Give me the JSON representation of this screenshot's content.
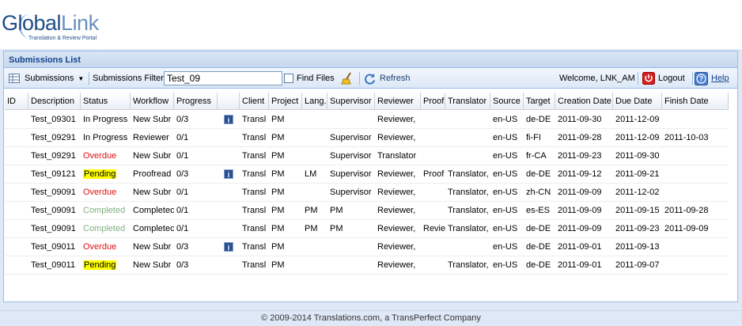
{
  "logo": {
    "name_part1": "Global",
    "name_part2": "Link",
    "subtitle": "Translation & Review Portal"
  },
  "panel": {
    "title": "Submissions List"
  },
  "toolbar": {
    "submissions_menu": "Submissions",
    "filter_label": "Submissions Filter",
    "filter_value": "Test_09",
    "find_files_label": "Find Files",
    "refresh_label": "Refresh",
    "welcome": "Welcome, LNK_AM",
    "logout_label": "Logout",
    "help_label": "Help"
  },
  "grid": {
    "columns": [
      "ID",
      "Description",
      "Status",
      "Workflow",
      "Progress",
      "",
      "Client",
      "Project",
      "Lang.",
      "Supervisor",
      "Reviewer",
      "Proof",
      "Translator",
      "Source",
      "Target",
      "Creation Date",
      "Due Date",
      "Finish Date"
    ],
    "rows": [
      {
        "description": "Test_09301",
        "status": "In Progress",
        "status_type": "normal",
        "workflow": "New Subr",
        "progress": "0/3",
        "info": true,
        "client": "Transl",
        "project": "PM",
        "lang": "",
        "supervisor": "",
        "reviewer": "Reviewer,",
        "proof": "",
        "translator": "",
        "source": "en-US",
        "target": "de-DE",
        "created": "2011-09-30",
        "due": "2011-12-09",
        "finish": ""
      },
      {
        "description": "Test_09291",
        "status": "In Progress",
        "status_type": "normal",
        "workflow": "Reviewer",
        "progress": "0/1",
        "info": false,
        "client": "Transl",
        "project": "PM",
        "lang": "",
        "supervisor": "Supervisor",
        "reviewer": "Reviewer,",
        "proof": "",
        "translator": "",
        "source": "en-US",
        "target": "fi-FI",
        "created": "2011-09-28",
        "due": "2011-12-09",
        "finish": "2011-10-03"
      },
      {
        "description": "Test_09291",
        "status": "Overdue",
        "status_type": "overdue",
        "workflow": "New Subr",
        "progress": "0/1",
        "info": false,
        "client": "Transl",
        "project": "PM",
        "lang": "",
        "supervisor": "Supervisor",
        "reviewer": "Translator",
        "proof": "",
        "translator": "",
        "source": "en-US",
        "target": "fr-CA",
        "created": "2011-09-23",
        "due": "2011-09-30",
        "finish": ""
      },
      {
        "description": "Test_09121",
        "status": "Pending",
        "status_type": "pending",
        "workflow": "Proofread",
        "progress": "0/3",
        "info": true,
        "client": "Transl",
        "project": "PM",
        "lang": "LM",
        "supervisor": "Supervisor",
        "reviewer": "Reviewer,",
        "proof": "Proof",
        "translator": "Translator,",
        "source": "en-US",
        "target": "de-DE",
        "created": "2011-09-12",
        "due": "2011-09-21",
        "finish": ""
      },
      {
        "description": "Test_09091",
        "status": "Overdue",
        "status_type": "overdue",
        "workflow": "New Subr",
        "progress": "0/1",
        "info": false,
        "client": "Transl",
        "project": "PM",
        "lang": "",
        "supervisor": "Supervisor",
        "reviewer": "Reviewer,",
        "proof": "",
        "translator": "Translator,",
        "source": "en-US",
        "target": "zh-CN",
        "created": "2011-09-09",
        "due": "2011-12-02",
        "finish": ""
      },
      {
        "description": "Test_09091",
        "status": "Completed",
        "status_type": "completed",
        "workflow": "Completec",
        "progress": "0/1",
        "info": false,
        "client": "Transl",
        "project": "PM",
        "lang": "PM",
        "supervisor": "PM",
        "reviewer": "Reviewer,",
        "proof": "",
        "translator": "Translator,",
        "source": "en-US",
        "target": "es-ES",
        "created": "2011-09-09",
        "due": "2011-09-15",
        "finish": "2011-09-28"
      },
      {
        "description": "Test_09091",
        "status": "Completed",
        "status_type": "completed",
        "workflow": "Completec",
        "progress": "0/1",
        "info": false,
        "client": "Transl",
        "project": "PM",
        "lang": "PM",
        "supervisor": "PM",
        "reviewer": "Reviewer,",
        "proof": "Revie",
        "translator": "Translator,",
        "source": "en-US",
        "target": "de-DE",
        "created": "2011-09-09",
        "due": "2011-09-23",
        "finish": "2011-09-09"
      },
      {
        "description": "Test_09011",
        "status": "Overdue",
        "status_type": "overdue",
        "workflow": "New Subr",
        "progress": "0/3",
        "info": true,
        "client": "Transl",
        "project": "PM",
        "lang": "",
        "supervisor": "",
        "reviewer": "Reviewer,",
        "proof": "",
        "translator": "",
        "source": "en-US",
        "target": "de-DE",
        "created": "2011-09-01",
        "due": "2011-09-13",
        "finish": ""
      },
      {
        "description": "Test_09011",
        "status": "Pending",
        "status_type": "pending",
        "workflow": "New Subr",
        "progress": "0/3",
        "info": false,
        "client": "Transl",
        "project": "PM",
        "lang": "",
        "supervisor": "",
        "reviewer": "Reviewer,",
        "proof": "",
        "translator": "Translator,",
        "source": "en-US",
        "target": "de-DE",
        "created": "2011-09-01",
        "due": "2011-09-07",
        "finish": ""
      }
    ]
  },
  "footer": {
    "text": "© 2009-2014 Translations.com, a TransPerfect Company"
  },
  "colors": {
    "overdue": "#e01010",
    "completed": "#80b080",
    "pending_highlight": "#ffff00",
    "panel_border": "#99bbe8",
    "title_text": "#15428b"
  }
}
